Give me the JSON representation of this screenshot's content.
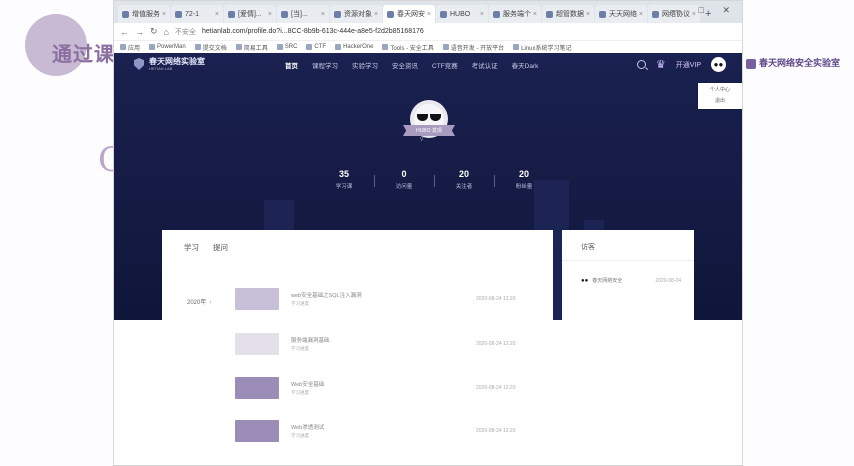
{
  "slide": {
    "title": "通过课",
    "watermark": "C",
    "side_logo": "春天网络安全实验室"
  },
  "browser": {
    "tabs": [
      {
        "label": "增值服务",
        "active": false
      },
      {
        "label": "72-1",
        "active": false
      },
      {
        "label": "[爱情]...",
        "active": false
      },
      {
        "label": "[当]...",
        "active": false
      },
      {
        "label": "资源对象",
        "active": false
      },
      {
        "label": "春天网安",
        "active": true
      },
      {
        "label": "HUBO",
        "active": false
      },
      {
        "label": "服务端个",
        "active": false
      },
      {
        "label": "超管数据",
        "active": false
      },
      {
        "label": "天天网络",
        "active": false
      },
      {
        "label": "网络协议",
        "active": false
      }
    ],
    "new_tab": "+",
    "window_controls": "— □ ✕",
    "address": {
      "secure": "不安全",
      "url": "hetianlab.com/profile.do?i...8CC-8b9b-613c-444e-a8e5-f2d2b85168176"
    },
    "bookmarks": [
      "应用",
      "PowerMan",
      "提交文档",
      "简易工具",
      "SRC",
      "CTF",
      "HackerOne",
      "Tools - 安全工具",
      "语音开发 - 开放平台",
      "Linux系统学习笔记"
    ]
  },
  "site": {
    "logo_title": "春天网络实验室",
    "logo_sub": "HETIAN LAB",
    "menu": [
      {
        "label": "首页",
        "active": true
      },
      {
        "label": "课程学习",
        "active": false
      },
      {
        "label": "实验学习",
        "active": false
      },
      {
        "label": "安全资讯",
        "active": false
      },
      {
        "label": "CTF竞赛",
        "active": false
      },
      {
        "label": "考试认证",
        "active": false
      },
      {
        "label": "春天Dark",
        "active": false
      }
    ],
    "vip_label": "开通VIP",
    "dropdown": [
      "个人中心",
      "退出"
    ],
    "profile": {
      "name": "HUBO 发现",
      "sub": "V"
    },
    "stats": [
      {
        "value": "35",
        "label": "学习课"
      },
      {
        "value": "0",
        "label": "访问量"
      },
      {
        "value": "20",
        "label": "关注者"
      },
      {
        "value": "20",
        "label": "粉丝量"
      }
    ],
    "card_tabs": [
      "学习",
      "提问"
    ],
    "year": "2020年",
    "courses": [
      {
        "title": "web安全基础之SQL注入漏洞",
        "sub": "学习进度",
        "date": "2020-08-24 12:20"
      },
      {
        "title": "服务端漏洞基础",
        "sub": "学习进度",
        "date": "2020-08-24 12:20"
      },
      {
        "title": "Web安全基础",
        "sub": "学习进度",
        "date": "2020-08-24 12:20"
      },
      {
        "title": "Web渗透测试",
        "sub": "学习进度",
        "date": "2020-08-24 12:20"
      }
    ],
    "visitors_title": "访客",
    "visitors": [
      {
        "name": "春天网络安全",
        "time": "2020-08-24"
      }
    ]
  }
}
